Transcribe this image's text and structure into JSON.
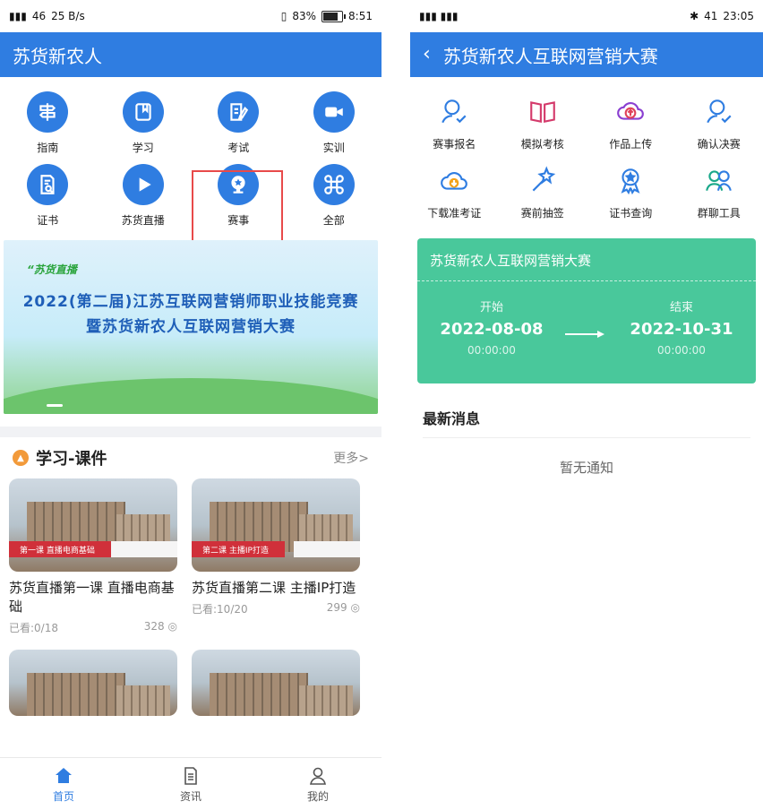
{
  "left": {
    "status": {
      "network": "46",
      "wifi_sub": "25 B/s",
      "battery_percent": "83%",
      "time": "8:51"
    },
    "app_title": "苏货新农人",
    "grid_items": [
      {
        "label": "指南",
        "icon": "signpost-icon"
      },
      {
        "label": "学习",
        "icon": "book-icon"
      },
      {
        "label": "考试",
        "icon": "edit-paper-icon"
      },
      {
        "label": "实训",
        "icon": "video-camera-icon"
      },
      {
        "label": "证书",
        "icon": "certificate-search-icon"
      },
      {
        "label": "苏货直播",
        "icon": "play-icon"
      },
      {
        "label": "赛事",
        "icon": "trophy-icon"
      },
      {
        "label": "全部",
        "icon": "command-icon"
      }
    ],
    "banner": {
      "brand": "“苏货直播",
      "title_line1": "2022(第二届)江苏互联网营销师职业技能竞赛",
      "title_line2": "暨苏货新农人互联网营销大赛"
    },
    "section": {
      "title": "学习-课件",
      "more": "更多>"
    },
    "cards": [
      {
        "ribbon": "第一课 直播电商基础",
        "title": "苏货直播第一课 直播电商基础",
        "viewed": "已看:0/18",
        "views": "328"
      },
      {
        "ribbon": "第二课 主播IP打造",
        "title": "苏货直播第二课 主播IP打造",
        "viewed": "已看:10/20",
        "views": "299"
      }
    ],
    "bottom_nav": [
      {
        "label": "首页",
        "active": true
      },
      {
        "label": "资讯",
        "active": false
      },
      {
        "label": "我的",
        "active": false
      }
    ]
  },
  "right": {
    "status": {
      "battery": "41",
      "time": "23:05"
    },
    "header_title": "苏货新农人互联网营销大赛",
    "grid_items": [
      {
        "label": "赛事报名",
        "icon": "person-check-icon",
        "color": "#2f7de1"
      },
      {
        "label": "模拟考核",
        "icon": "open-book-icon",
        "color": "#d43a6b"
      },
      {
        "label": "作品上传",
        "icon": "cloud-upload-icon",
        "color": "#8a3fd1"
      },
      {
        "label": "确认决赛",
        "icon": "person-check-icon",
        "color": "#2f7de1"
      },
      {
        "label": "下载准考证",
        "icon": "cloud-download-icon",
        "color": "#f3a21a"
      },
      {
        "label": "赛前抽签",
        "icon": "magic-wand-icon",
        "color": "#2f7de1"
      },
      {
        "label": "证书查询",
        "icon": "award-icon",
        "color": "#2f7de1"
      },
      {
        "label": "群聊工具",
        "icon": "group-icon",
        "color": "#1aa88a"
      }
    ],
    "contest": {
      "name": "苏货新农人互联网营销大赛",
      "start_label": "开始",
      "start_date": "2022-08-08",
      "start_time": "00:00:00",
      "end_label": "结束",
      "end_date": "2022-10-31",
      "end_time": "00:00:00",
      "color": "#49c89b"
    },
    "news": {
      "title": "最新消息",
      "empty": "暂无通知"
    }
  }
}
